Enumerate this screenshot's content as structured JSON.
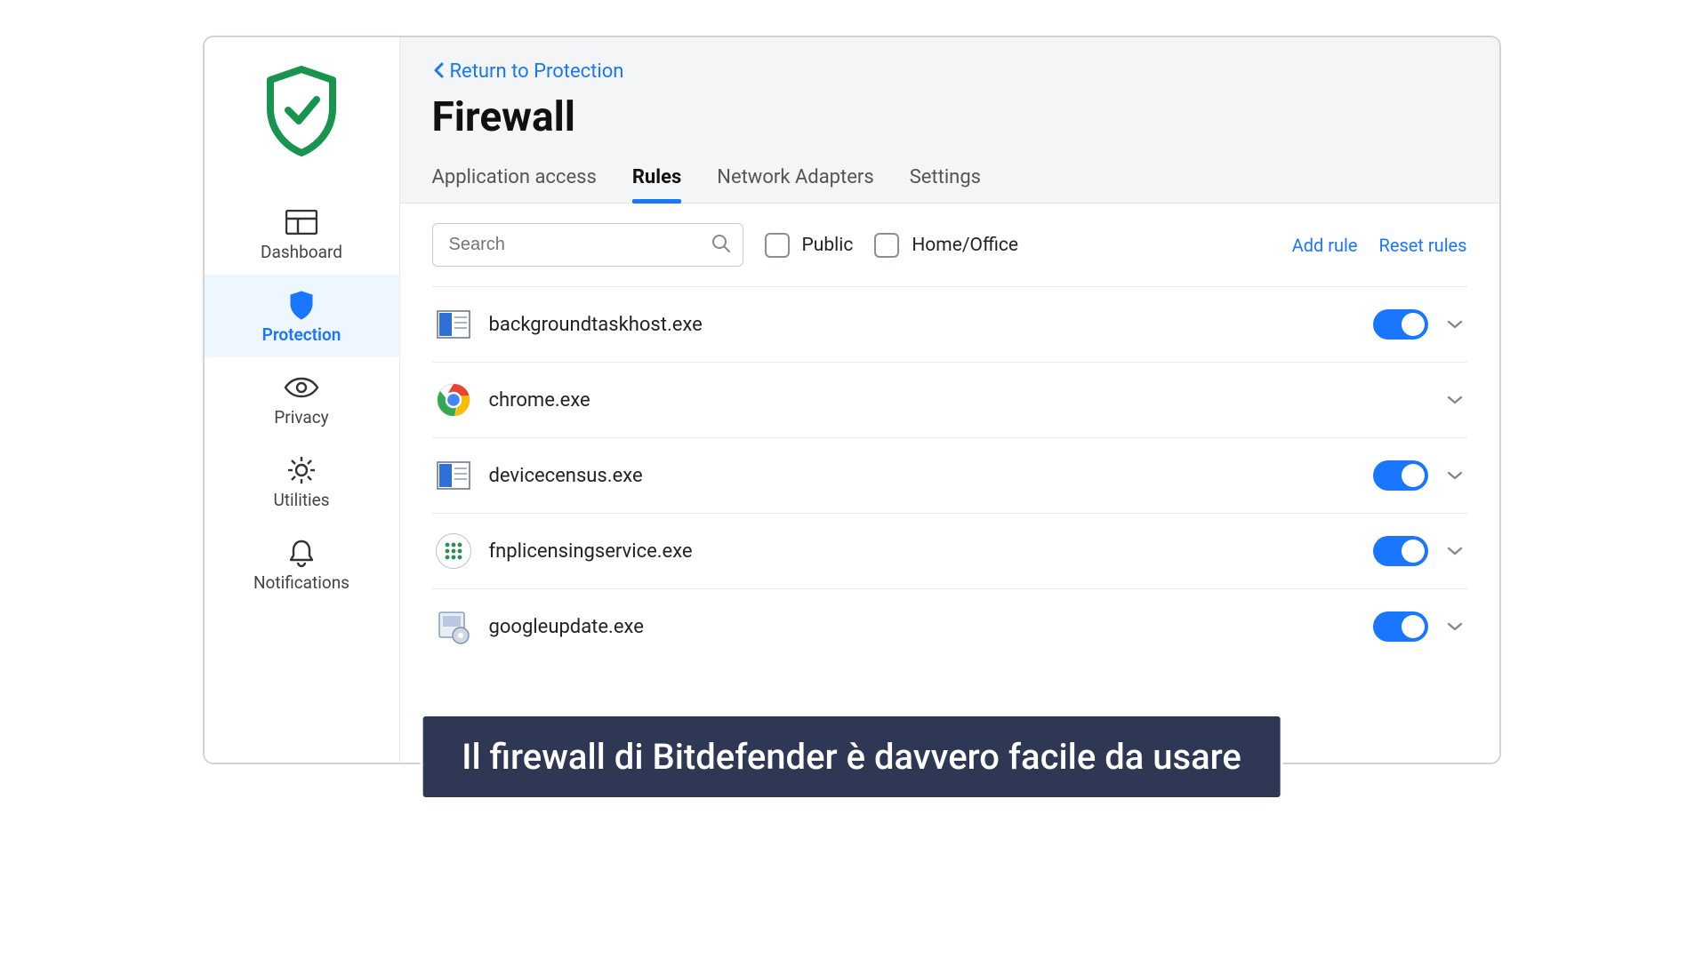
{
  "sidebar": {
    "items": [
      {
        "label": "Dashboard"
      },
      {
        "label": "Protection"
      },
      {
        "label": "Privacy"
      },
      {
        "label": "Utilities"
      },
      {
        "label": "Notifications"
      }
    ]
  },
  "header": {
    "back_label": "Return to Protection",
    "title": "Firewall",
    "tabs": [
      {
        "label": "Application access"
      },
      {
        "label": "Rules"
      },
      {
        "label": "Network Adapters"
      },
      {
        "label": "Settings"
      }
    ]
  },
  "toolbar": {
    "search_placeholder": "Search",
    "public_label": "Public",
    "home_office_label": "Home/Office",
    "add_rule": "Add rule",
    "reset_rules": "Reset rules"
  },
  "rules": [
    {
      "name": "backgroundtaskhost.exe",
      "icon": "window-exe",
      "toggle": true
    },
    {
      "name": "chrome.exe",
      "icon": "chrome",
      "toggle": null
    },
    {
      "name": "devicecensus.exe",
      "icon": "window-exe",
      "toggle": true
    },
    {
      "name": "fnplicensingservice.exe",
      "icon": "dots-grid",
      "toggle": true
    },
    {
      "name": "googleupdate.exe",
      "icon": "installer",
      "toggle": true
    }
  ],
  "caption": "Il firewall di Bitdefender è davvero facile da usare"
}
